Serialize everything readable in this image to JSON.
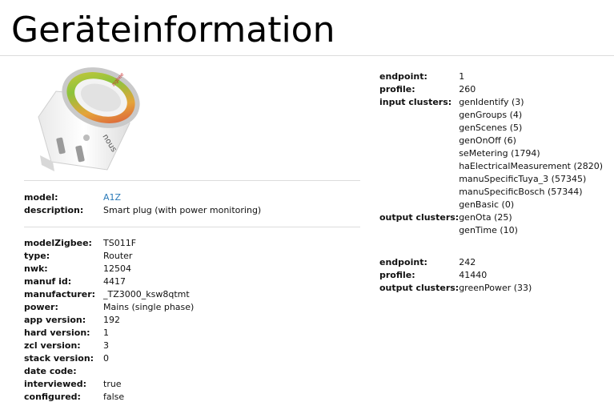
{
  "page": {
    "title": "Geräteinformation"
  },
  "device": {
    "image_alt": "Smart plug",
    "image_brand": "nous",
    "image_ring_label": "zigbee"
  },
  "summary": {
    "model_label": "model:",
    "model_value": "A1Z",
    "description_label": "description:",
    "description_value": "Smart plug (with power monitoring)"
  },
  "details": [
    {
      "label": "modelZigbee:",
      "value": "TS011F"
    },
    {
      "label": "type:",
      "value": "Router"
    },
    {
      "label": "nwk:",
      "value": "12504"
    },
    {
      "label": "manuf id:",
      "value": "4417"
    },
    {
      "label": "manufacturer:",
      "value": "_TZ3000_ksw8qtmt"
    },
    {
      "label": "power:",
      "value": "Mains (single phase)"
    },
    {
      "label": "app version:",
      "value": "192"
    },
    {
      "label": "hard version:",
      "value": "1"
    },
    {
      "label": "zcl version:",
      "value": "3"
    },
    {
      "label": "stack version:",
      "value": "0"
    },
    {
      "label": "date code:",
      "value": ""
    },
    {
      "label": "interviewed:",
      "value": "true"
    },
    {
      "label": "configured:",
      "value": "false"
    }
  ],
  "endpoints": [
    {
      "endpoint_label": "endpoint:",
      "endpoint": "1",
      "profile_label": "profile:",
      "profile": "260",
      "input_label": "input clusters:",
      "input_clusters": [
        "genIdentify (3)",
        "genGroups (4)",
        "genScenes (5)",
        "genOnOff (6)",
        "seMetering (1794)",
        "haElectricalMeasurement (2820)",
        "manuSpecificTuya_3 (57345)",
        "manuSpecificBosch (57344)",
        "genBasic (0)"
      ],
      "output_label": "output clusters:",
      "output_clusters": [
        "genOta (25)",
        "genTime (10)"
      ]
    },
    {
      "endpoint_label": "endpoint:",
      "endpoint": "242",
      "profile_label": "profile:",
      "profile": "41440",
      "output_label": "output clusters:",
      "output_clusters": [
        "greenPower (33)"
      ]
    }
  ],
  "colors": {
    "link": "#2a7ab8",
    "rule": "#dcdcdc"
  }
}
